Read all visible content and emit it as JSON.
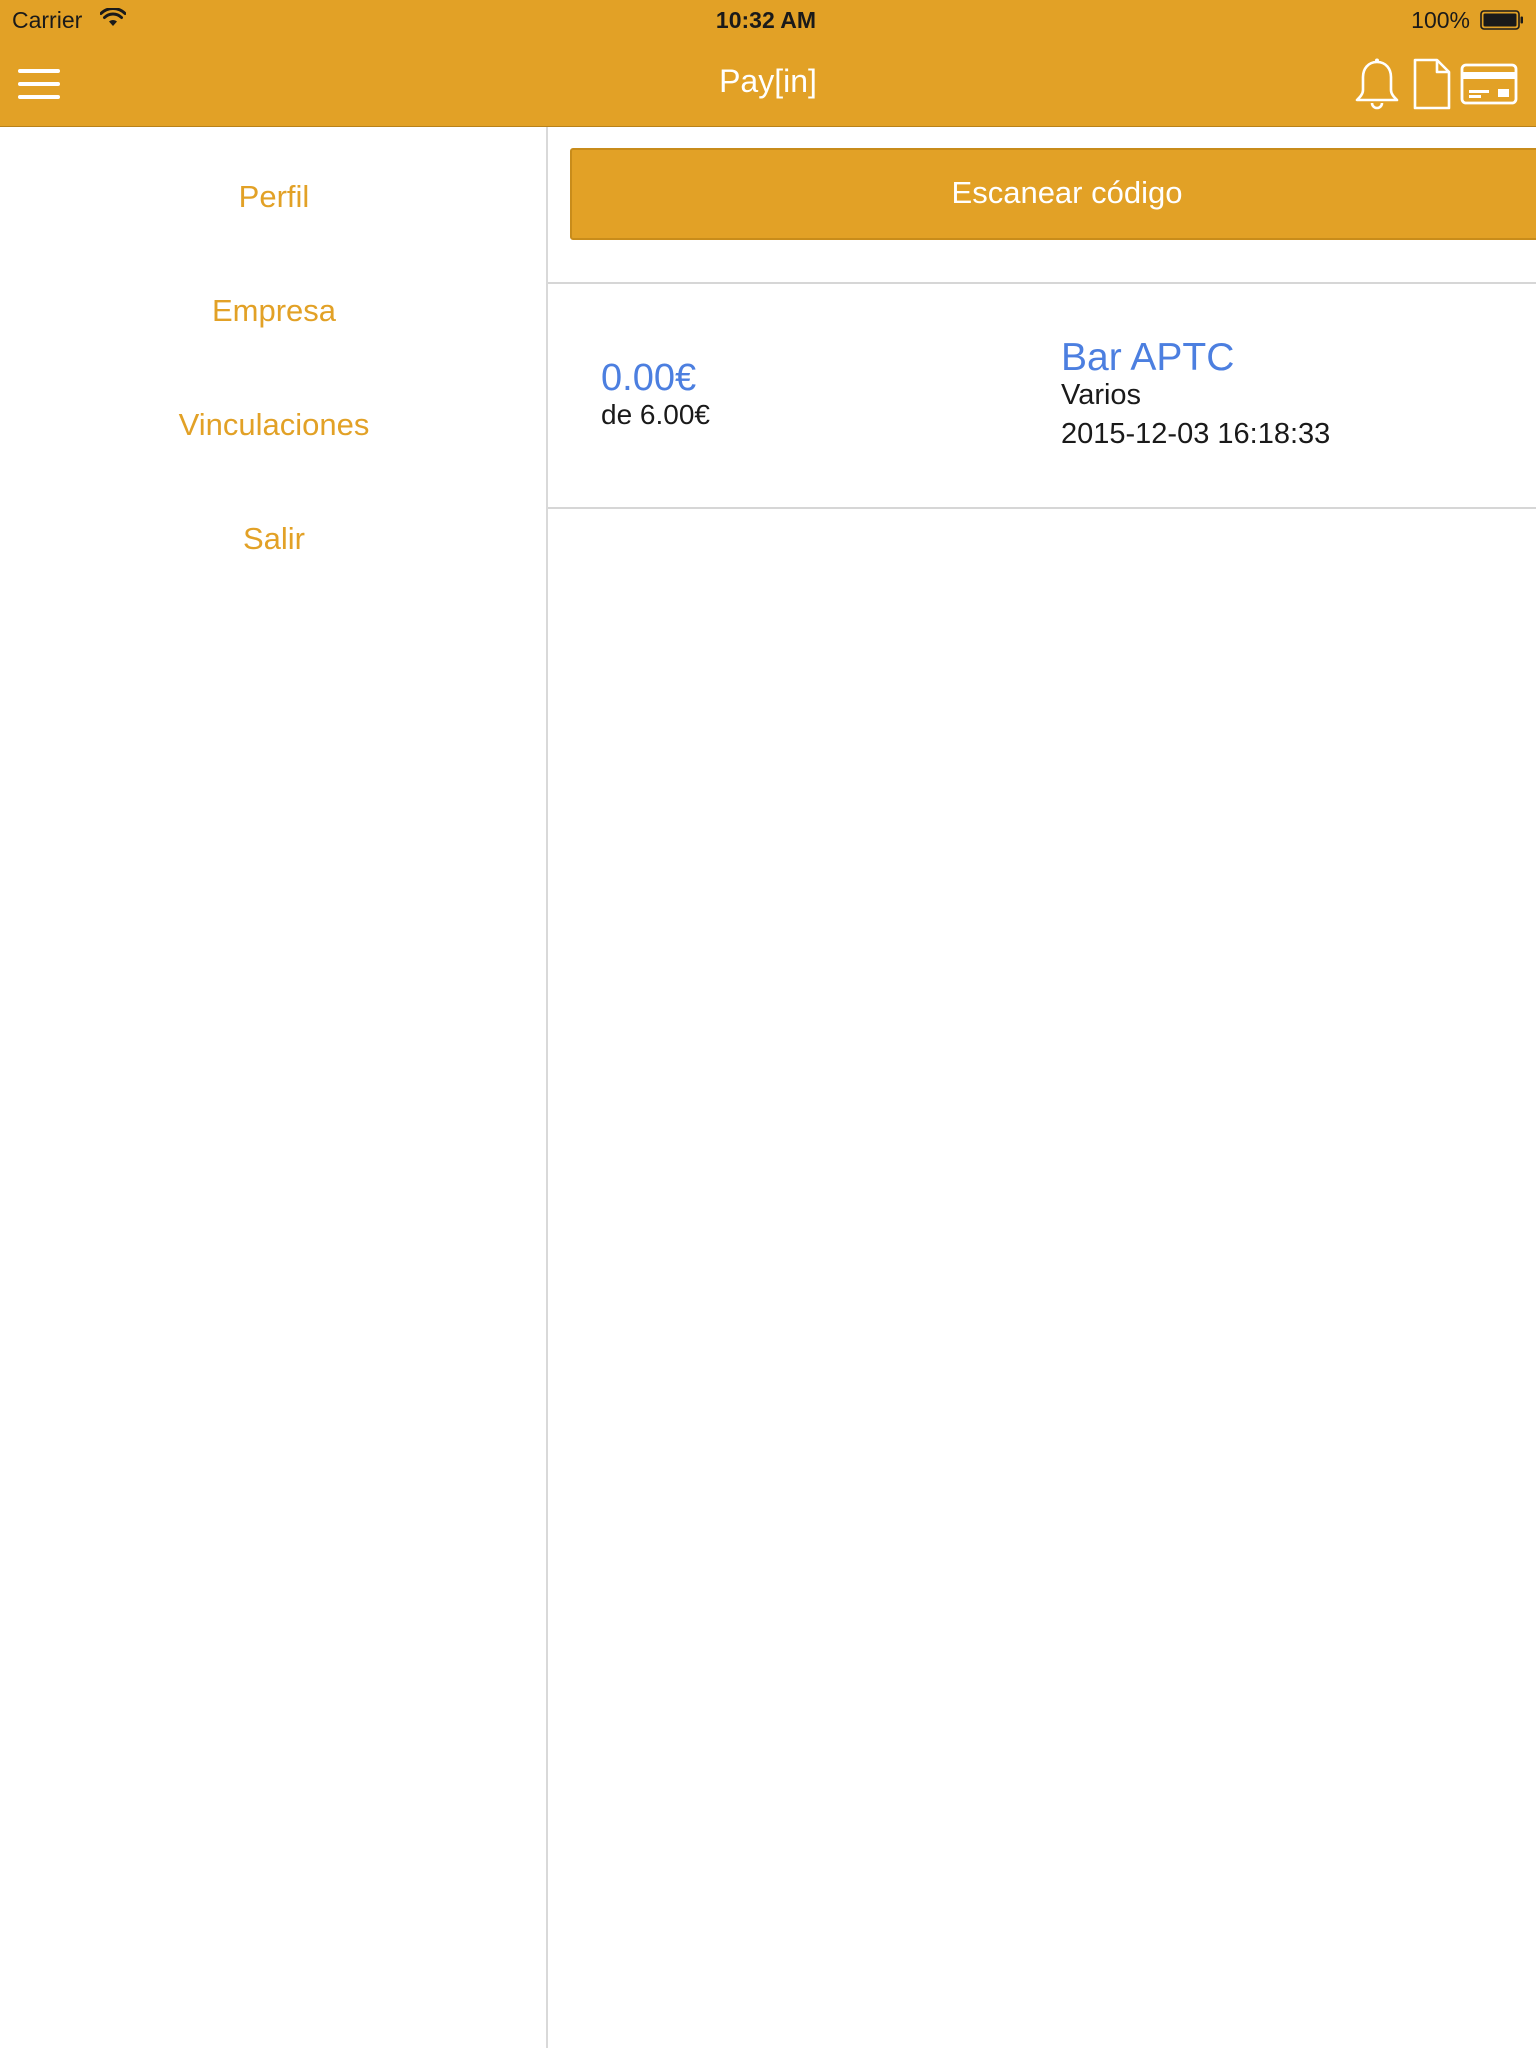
{
  "status_bar": {
    "carrier": "Carrier",
    "time": "10:32 AM",
    "battery": "100%"
  },
  "nav": {
    "title": "Pay[in]",
    "icons": [
      "menu-icon",
      "bell-icon",
      "document-icon",
      "credit-card-icon"
    ]
  },
  "sidebar": {
    "items": [
      {
        "label": "Perfil"
      },
      {
        "label": "Empresa"
      },
      {
        "label": "Vinculaciones"
      },
      {
        "label": "Salir"
      }
    ]
  },
  "main": {
    "scan_button": "Escanear código",
    "transactions": [
      {
        "amount": "0.00€",
        "of_total": "de 6.00€",
        "merchant": "Bar APTC",
        "category": "Varios",
        "datetime": "2015-12-03 16:18:33"
      }
    ]
  },
  "colors": {
    "accent": "#E2A126",
    "link_blue": "#4C7FE0"
  }
}
